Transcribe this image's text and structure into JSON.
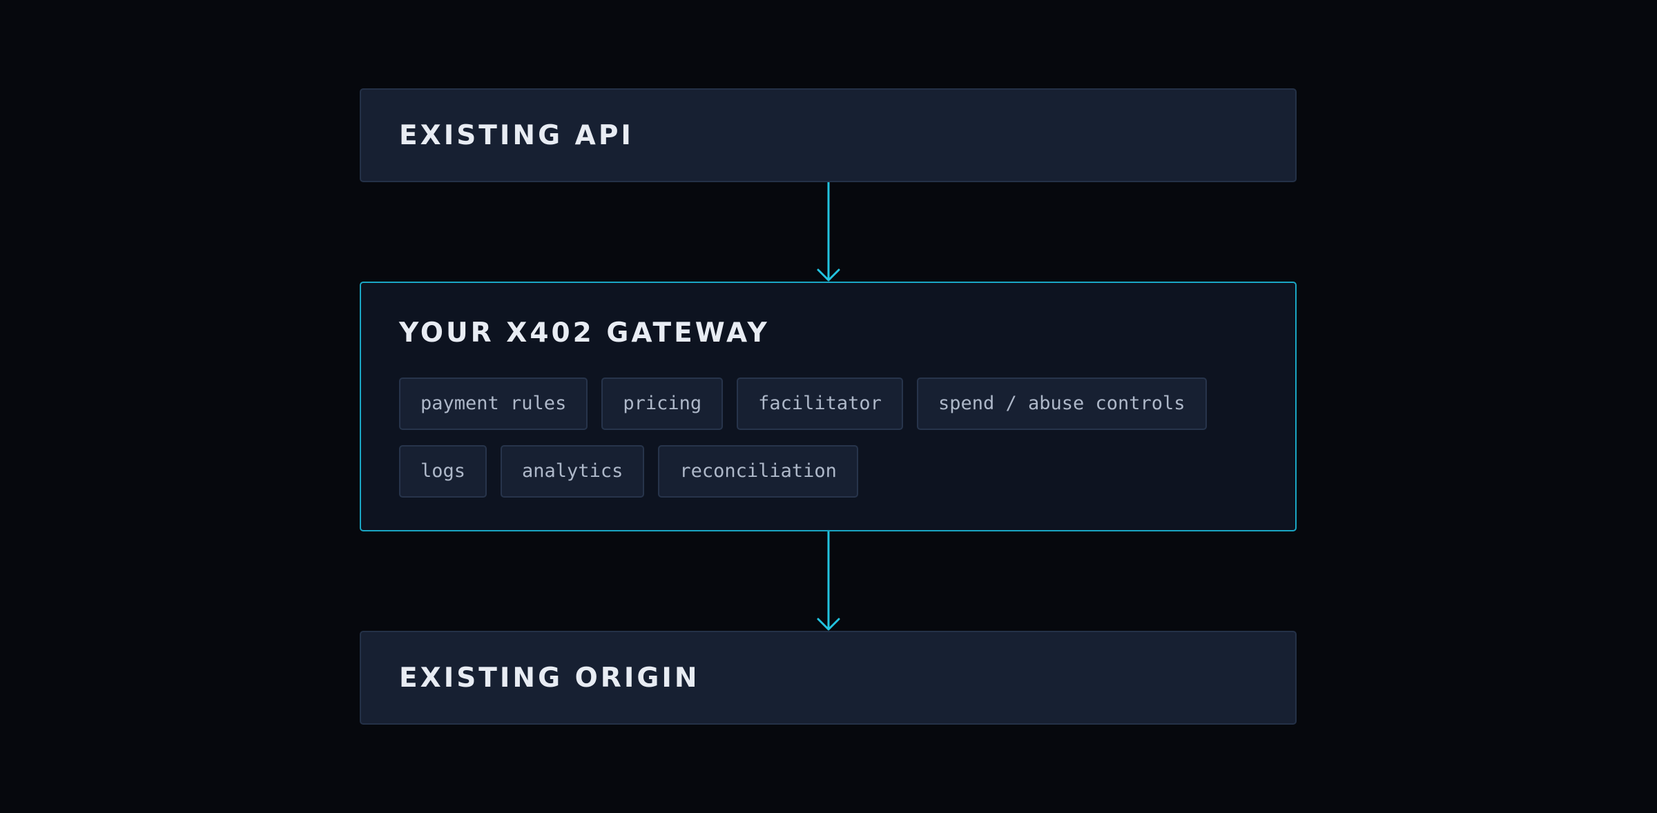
{
  "diagram": {
    "nodes": [
      {
        "id": "api",
        "title": "EXISTING API"
      },
      {
        "id": "gateway",
        "title": "YOUR X402 GATEWAY",
        "chip_rows": [
          [
            "payment rules",
            "pricing",
            "facilitator",
            "spend / abuse controls"
          ],
          [
            "logs",
            "analytics",
            "reconciliation"
          ]
        ]
      },
      {
        "id": "origin",
        "title": "EXISTING ORIGIN"
      }
    ],
    "edges": [
      {
        "from": "api",
        "to": "gateway"
      },
      {
        "from": "gateway",
        "to": "origin"
      }
    ],
    "colors": {
      "background": "#06080d",
      "box_fill": "#172032",
      "gateway_fill": "#0d1320",
      "accent": "#1aa6c4",
      "arrow": "#22c3df",
      "title_text": "#e8ecf3",
      "chip_text": "#aeb8c9"
    }
  }
}
